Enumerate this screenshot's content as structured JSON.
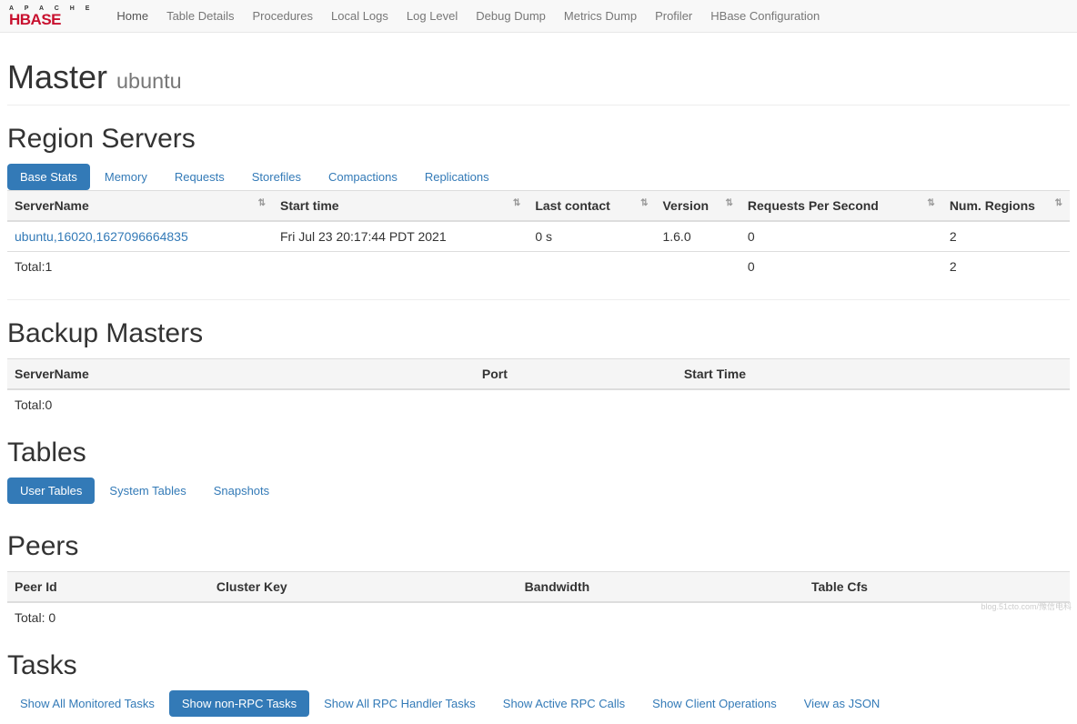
{
  "logo": {
    "top": "A P A C H E",
    "bottom": "HBASE"
  },
  "nav": {
    "items": [
      "Home",
      "Table Details",
      "Procedures",
      "Local Logs",
      "Log Level",
      "Debug Dump",
      "Metrics Dump",
      "Profiler",
      "HBase Configuration"
    ],
    "active": 0
  },
  "header": {
    "title": "Master",
    "subtitle": "ubuntu"
  },
  "regionServers": {
    "title": "Region Servers",
    "tabs": [
      "Base Stats",
      "Memory",
      "Requests",
      "Storefiles",
      "Compactions",
      "Replications"
    ],
    "activeTab": 0,
    "columns": [
      "ServerName",
      "Start time",
      "Last contact",
      "Version",
      "Requests Per Second",
      "Num. Regions"
    ],
    "rows": [
      {
        "serverName": "ubuntu,16020,1627096664835",
        "startTime": "Fri Jul 23 20:17:44 PDT 2021",
        "lastContact": "0 s",
        "version": "1.6.0",
        "rps": "0",
        "numRegions": "2"
      }
    ],
    "totals": {
      "label": "Total:1",
      "rps": "0",
      "numRegions": "2"
    }
  },
  "backupMasters": {
    "title": "Backup Masters",
    "columns": [
      "ServerName",
      "Port",
      "Start Time"
    ],
    "total": "Total:0"
  },
  "tables": {
    "title": "Tables",
    "tabs": [
      "User Tables",
      "System Tables",
      "Snapshots"
    ],
    "activeTab": 0
  },
  "peers": {
    "title": "Peers",
    "columns": [
      "Peer Id",
      "Cluster Key",
      "Bandwidth",
      "Table Cfs"
    ],
    "total": "Total: 0"
  },
  "tasks": {
    "title": "Tasks",
    "tabs": [
      "Show All Monitored Tasks",
      "Show non-RPC Tasks",
      "Show All RPC Handler Tasks",
      "Show Active RPC Calls",
      "Show Client Operations",
      "View as JSON"
    ],
    "activeTab": 1
  },
  "watermark": "blog.51cto.com/豫信电科"
}
